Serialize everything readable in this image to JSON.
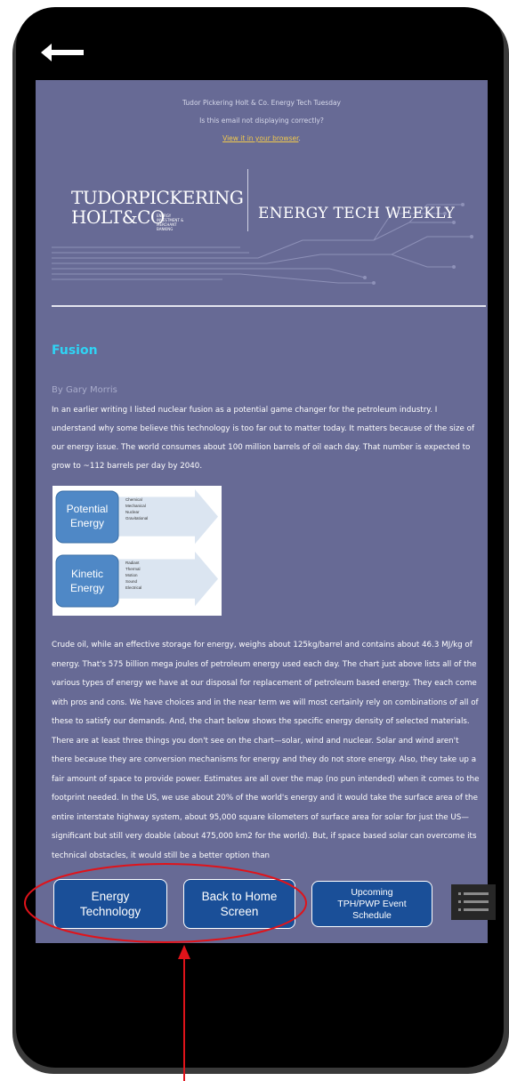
{
  "header": {
    "back_icon": "arrow-left-icon"
  },
  "email": {
    "preheader_title": "Tudor Pickering Holt & Co. Energy Tech Tuesday",
    "preheader_question": "Is this email not displaying correctly?",
    "preheader_link": "View it in your browser",
    "preheader_link_suffix": "."
  },
  "brand": {
    "logo_line1": "TUDORPICKERING",
    "logo_line2": "HOLT&CO",
    "logo_small_1": "ENERGY INVESTMENT &",
    "logo_small_2": "MERCHANT BANKING",
    "newsletter_title": "ENERGY TECH WEEKLY"
  },
  "article": {
    "title": "Fusion",
    "byline": "By Gary Morris",
    "paragraph1": "In an earlier writing I listed nuclear fusion as a potential game changer for the petroleum industry. I understand why some believe this technology is too far out to matter today. It matters because of the size of our energy issue. The world consumes about 100 million barrels of oil each day. That number is expected to grow to ~112 barrels per day by 2040.",
    "paragraph2": "Crude oil, while an effective storage for energy, weighs about 125kg/barrel and contains about 46.3 MJ/kg of energy. That's 575 billion mega joules of petroleum energy used each day. The chart just above lists all of the various types of energy we have at our disposal for replacement of petroleum based energy. They each come with pros and cons.  We have choices and in the near term we will most certainly rely on combinations of all of these to satisfy our demands. And, the chart below shows the specific energy density of selected materials. There are at least three things you don't see on the chart—solar, wind and nuclear.  Solar and wind aren't there because they are conversion mechanisms for energy and they do not store energy. Also, they take up a fair amount of space to provide power. Estimates are all over the map (no pun intended) when it comes to the footprint needed. In the US, we use about 20% of the world's energy and it would take the surface area of the entire interstate highway system, about 95,000 square kilometers of surface area for solar for just the US—significant but still very doable (about 475,000 km2 for the world). But, if space based solar can overcome its technical obstacles, it would still be a better option than"
  },
  "figure": {
    "potential_label_1": "Potential",
    "potential_label_2": "Energy",
    "potential_items": [
      "Chemical",
      "Mechanical",
      "Nuclear",
      "Gravitational"
    ],
    "kinetic_label_1": "Kinetic",
    "kinetic_label_2": "Energy",
    "kinetic_items": [
      "Radiant",
      "Thermal",
      "Motion",
      "Sound",
      "Electrical"
    ]
  },
  "nav": {
    "energy_line1": "Energy",
    "energy_line2": "Technology",
    "home_line1": "Back to Home",
    "home_line2": "Screen",
    "events_line1": "Upcoming",
    "events_line2": "TPH/PWP Event",
    "events_line3": "Schedule",
    "menu_icon": "hamburger-menu-icon"
  },
  "colors": {
    "screen_bg": "#676a95",
    "title_accent": "#2fd4f5",
    "link": "#f2c94c",
    "button_bg": "#1a4f98",
    "annotation": "#e0131a"
  }
}
